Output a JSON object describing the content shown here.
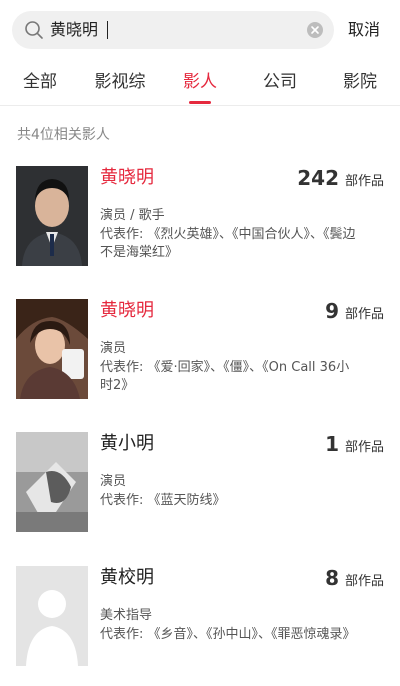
{
  "search": {
    "query": "黄晓明",
    "cancel_label": "取消"
  },
  "tabs": [
    {
      "label": "全部"
    },
    {
      "label": "影视综"
    },
    {
      "label": "影人"
    },
    {
      "label": "公司"
    },
    {
      "label": "影院"
    }
  ],
  "active_tab": "影人",
  "accent_color": "#e5293e",
  "result_count": "共4位相关影人",
  "results": [
    {
      "name": "黄晓明",
      "works_count": "242",
      "works_unit": "部作品",
      "role": "演员 / 歌手",
      "representative_works": "代表作: 《烈火英雄》、《中国合伙人》、《鬓边不是海棠红》"
    },
    {
      "name": "黄晓明",
      "works_count": "9",
      "works_unit": "部作品",
      "role": "演员",
      "representative_works": "代表作: 《爱·回家》、《僵》、《On Call 36小时2》"
    },
    {
      "name": "黄小明",
      "works_count": "1",
      "works_unit": "部作品",
      "role": "演员",
      "representative_works": "代表作: 《蓝天防线》"
    },
    {
      "name": "黄校明",
      "works_count": "8",
      "works_unit": "部作品",
      "role": "美术指导",
      "representative_works": "代表作: 《乡音》、《孙中山》、《罪恶惊魂录》"
    }
  ]
}
